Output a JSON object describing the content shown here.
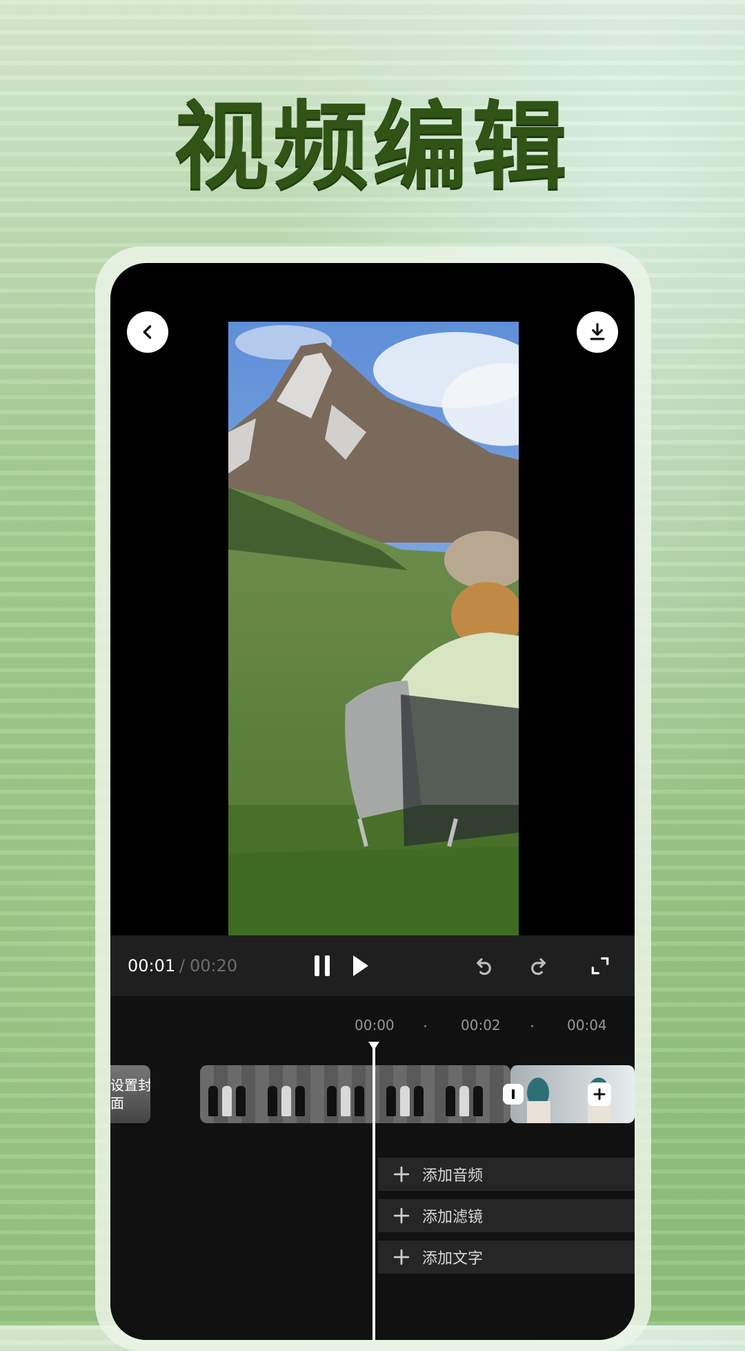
{
  "headline": "视频编辑",
  "player": {
    "current_time": "00:01",
    "separator": "/",
    "total_time": "00:20"
  },
  "timeline": {
    "ticks": [
      "00:00",
      "00:02",
      "00:04"
    ],
    "cover_label": "设置封面",
    "tracks": [
      {
        "label": "添加音频"
      },
      {
        "label": "添加滤镜"
      },
      {
        "label": "添加文字"
      }
    ]
  },
  "icons": {
    "back": "chevron-left-icon",
    "download": "download-icon",
    "pause": "pause-icon",
    "play": "play-icon",
    "undo": "undo-icon",
    "redo": "redo-icon",
    "fullscreen": "fullscreen-icon",
    "add": "plus-icon"
  },
  "colors": {
    "headline": "#2f5416",
    "screen_bg": "#000000",
    "control_bar": "#1f1f1f",
    "timeline_bg": "#111111",
    "track_bg": "#262626"
  }
}
